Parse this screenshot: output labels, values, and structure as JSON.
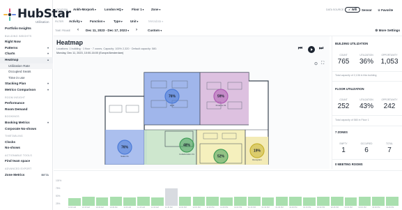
{
  "app": {
    "name": "HubStar",
    "sub": "Utilisation"
  },
  "sidebar": {
    "items": [
      {
        "label": "Portfolio Insights",
        "kind": "item"
      },
      {
        "label": "BUILDING INSIGHTS",
        "kind": "section"
      },
      {
        "label": "Right Now",
        "kind": "item"
      },
      {
        "label": "Patterns",
        "kind": "item",
        "chev": "▾"
      },
      {
        "label": "Charts",
        "kind": "item",
        "chev": "▾"
      },
      {
        "label": "Heatmap",
        "kind": "item",
        "chev": "▴",
        "state": "active"
      },
      {
        "label": "Utilization Rate",
        "kind": "sub",
        "state": "highlight"
      },
      {
        "label": "Occupied Seats",
        "kind": "sub"
      },
      {
        "label": "Time in use",
        "kind": "sub"
      },
      {
        "label": "Stacking Plan",
        "kind": "item",
        "chev": "▾"
      },
      {
        "label": "Metrics Comparison",
        "kind": "item",
        "chev": "▾"
      },
      {
        "label": "ROOM INSIGHT",
        "kind": "section"
      },
      {
        "label": "Performance",
        "kind": "item"
      },
      {
        "label": "Room Demand",
        "kind": "item"
      },
      {
        "label": "BOOKINGS",
        "kind": "section"
      },
      {
        "label": "Booking Metrics",
        "kind": "item",
        "chev": "▾"
      },
      {
        "label": "Corporate No-shows",
        "kind": "item"
      },
      {
        "label": "TIMETABLING",
        "kind": "section"
      },
      {
        "label": "Clocks",
        "kind": "item"
      },
      {
        "label": "No-shows",
        "kind": "item"
      },
      {
        "label": "ACTIONABLE TOOLS",
        "kind": "section"
      },
      {
        "label": "Find team space",
        "kind": "item"
      },
      {
        "label": "ADVANCED EXPORT",
        "kind": "section"
      },
      {
        "label": "Zone Metrics",
        "kind": "item",
        "chev": "BETA"
      }
    ]
  },
  "filters": {
    "location_label": "LOCATION",
    "location_values": [
      "Ankh-Morpork",
      "London HQ",
      "Floor 1",
      "Zone"
    ],
    "filter_label": "FILTER",
    "filter_values": [
      "Activity",
      "Function",
      "Type",
      "Unit",
      "Metadata"
    ],
    "data_source_label": "DATA SOURCE",
    "data_sources": [
      "Wifi",
      "Sensor",
      "Favorite"
    ]
  },
  "timeframe": {
    "label": "TIME FRAME",
    "prev": "‹",
    "next": "›",
    "range": "Dec 11, 2023 - Dec 17, 2023",
    "custom": "Custom",
    "more": "More Settings"
  },
  "heatmap": {
    "title": "Heatmap",
    "meta": "Locations: 1 building · 1 floor · 7 zones. Capacity: 100% 2,320 · Default capacity: 580.",
    "meta2": "Monday, Dec 11, 2023, 10:00-16:00 (Europe/Amsterdam)",
    "zones": [
      {
        "pct": "76%",
        "name": "HQ2",
        "color": "#4b7bd8"
      },
      {
        "pct": "59%",
        "name": "Finance 01",
        "color": "#b05cb5"
      },
      {
        "pct": "48%",
        "name": "Collaboration 01",
        "color": "#3f9c56"
      },
      {
        "pct": "76%",
        "name": "Sales 01",
        "color": "#4b7bd8"
      },
      {
        "pct": "19%",
        "name": "Reception",
        "color": "#c7b22f"
      },
      {
        "pct": "52%",
        "name": "Lounge 01",
        "color": "#3f9c56"
      }
    ]
  },
  "right_panel": {
    "building": {
      "title": "BUILDING UTILIZATION",
      "labels": [
        "COUNT",
        "UTILIZATION",
        "OPPORTUNITY"
      ],
      "values": [
        "765",
        "36%",
        "1,053"
      ],
      "note": "Total capacity of 2,136 in this building"
    },
    "floor": {
      "title": "FLOOR UTILIZATION",
      "labels": [
        "COUNT",
        "UTILIZATION",
        "OPPORTUNITY"
      ],
      "values": [
        "252",
        "43%",
        "242"
      ],
      "note": "Total capacity of 580 in Floor 1"
    },
    "zones": {
      "title": "7 ZONES",
      "labels": [
        "EMPTY",
        "OCCUPIED",
        "TOTAL"
      ],
      "values": [
        "1",
        "6",
        "7"
      ]
    },
    "meeting_rooms": "0 MEETING ROOMS"
  },
  "timeline": {
    "y_labels": [
      "100%",
      "75%",
      "50%",
      "25%"
    ],
    "bars": [
      0.3,
      0.33,
      0.31,
      0.34,
      0.32,
      0.33,
      0.31,
      0.66,
      0.33,
      0.35,
      0.34,
      0.32,
      0.33,
      0.34,
      0.32,
      0.35,
      0.33,
      0.31,
      0.34,
      0.33,
      0.32,
      0.34,
      0.33,
      0.35
    ],
    "highlight_index": 7,
    "x_labels": [
      "10:00 AM",
      "10:15 AM",
      "10:30 AM",
      "10:45 AM",
      "11:00 AM",
      "11:15 AM",
      "11:30 AM",
      "11:45 AM",
      "12:00 PM",
      "12:15 PM",
      "12:30 PM",
      "12:45 PM",
      "01:00 PM",
      "01:15 PM",
      "01:30 PM",
      "01:45 PM",
      "02:00 PM",
      "02:15 PM",
      "02:30 PM",
      "02:45 PM",
      "03:00 PM",
      "03:15 PM",
      "03:30 PM",
      "03:45 PM"
    ]
  }
}
